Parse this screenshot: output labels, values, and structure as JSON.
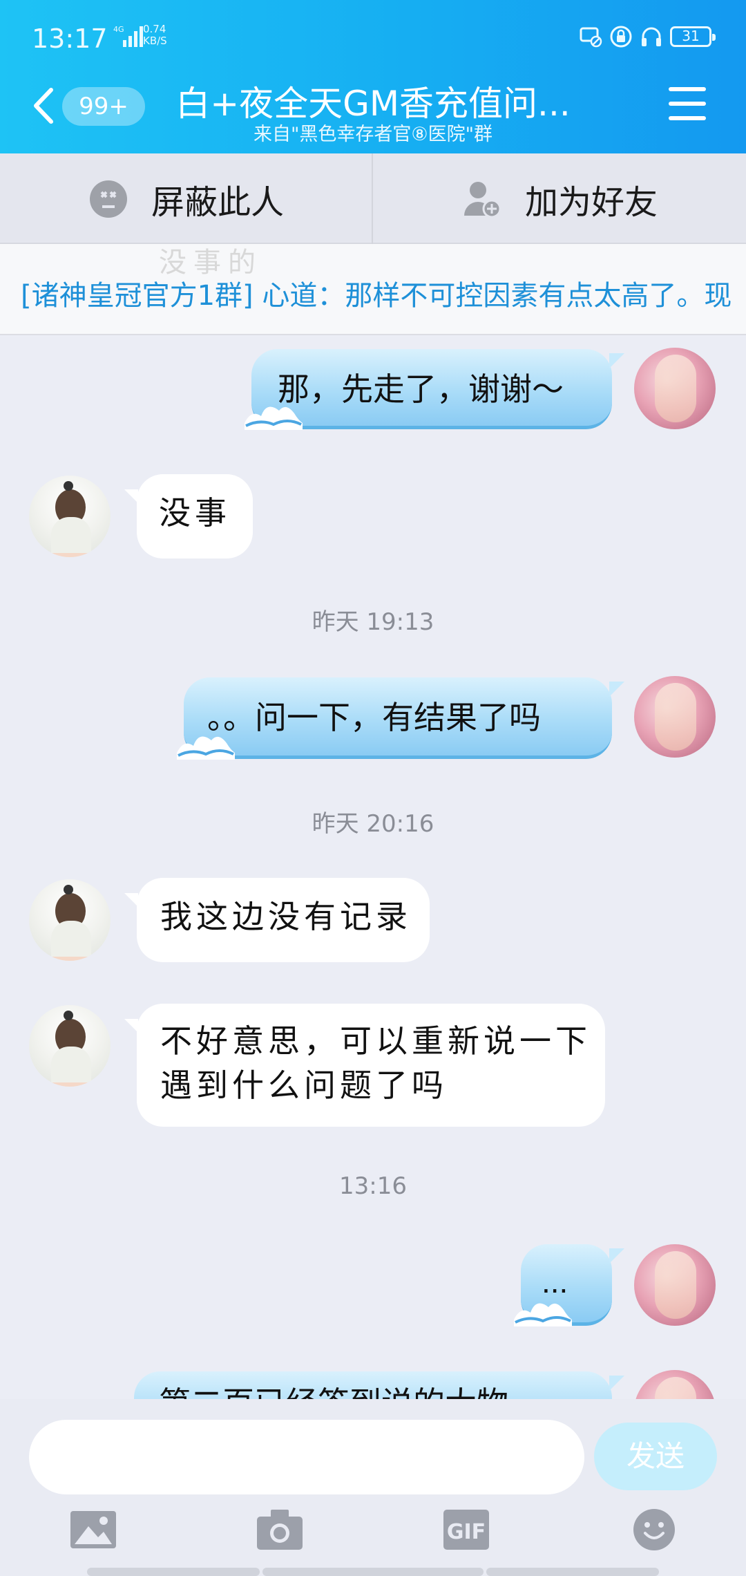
{
  "status_bar": {
    "time": "13:17",
    "network": "4G",
    "speed_value": "0.74",
    "speed_unit": "KB/S",
    "battery": "31",
    "icons": [
      "message-muted-icon",
      "lock-rotate-icon",
      "headphones-icon"
    ]
  },
  "header": {
    "back_badge": "99+",
    "title": "白+夜全天GM香充值问...",
    "subtitle": "来自\"黑色幸存者官⑧医院\"群"
  },
  "actions": {
    "block_label": "屏蔽此人",
    "add_friend_label": "加为好友"
  },
  "notice": {
    "ghost_text": "没事的",
    "text": "[诸神皇冠官方1群] 心道：那样不可控因素有点太高了。现"
  },
  "messages": [
    {
      "from": "self",
      "text": "那，先走了，谢谢～"
    },
    {
      "from": "other",
      "text": "没事"
    },
    {
      "time": "昨天 19:13"
    },
    {
      "from": "self",
      "text": "。。问一下，有结果了吗"
    },
    {
      "time": "昨天 20:16"
    },
    {
      "from": "other",
      "text": "我这边没有记录"
    },
    {
      "from": "other",
      "text_line1": "不好意思，可以重新说一下",
      "text_line2": "遇到什么问题了吗"
    },
    {
      "time": "13:16"
    },
    {
      "from": "self",
      "text": "..."
    },
    {
      "from": "self",
      "text": "第二页已经答到说的大物"
    }
  ],
  "input": {
    "placeholder": "",
    "send_label": "发送"
  },
  "toolbar": {
    "icons": [
      "image-icon",
      "camera-icon",
      "gif-icon",
      "emoji-icon"
    ],
    "gif_label": "GIF"
  },
  "colors": {
    "header_start": "#1ec3f5",
    "header_end": "#1499f0",
    "notice_text": "#1e90d8",
    "send_button": "#c5eefc",
    "background": "#ebedf5"
  }
}
